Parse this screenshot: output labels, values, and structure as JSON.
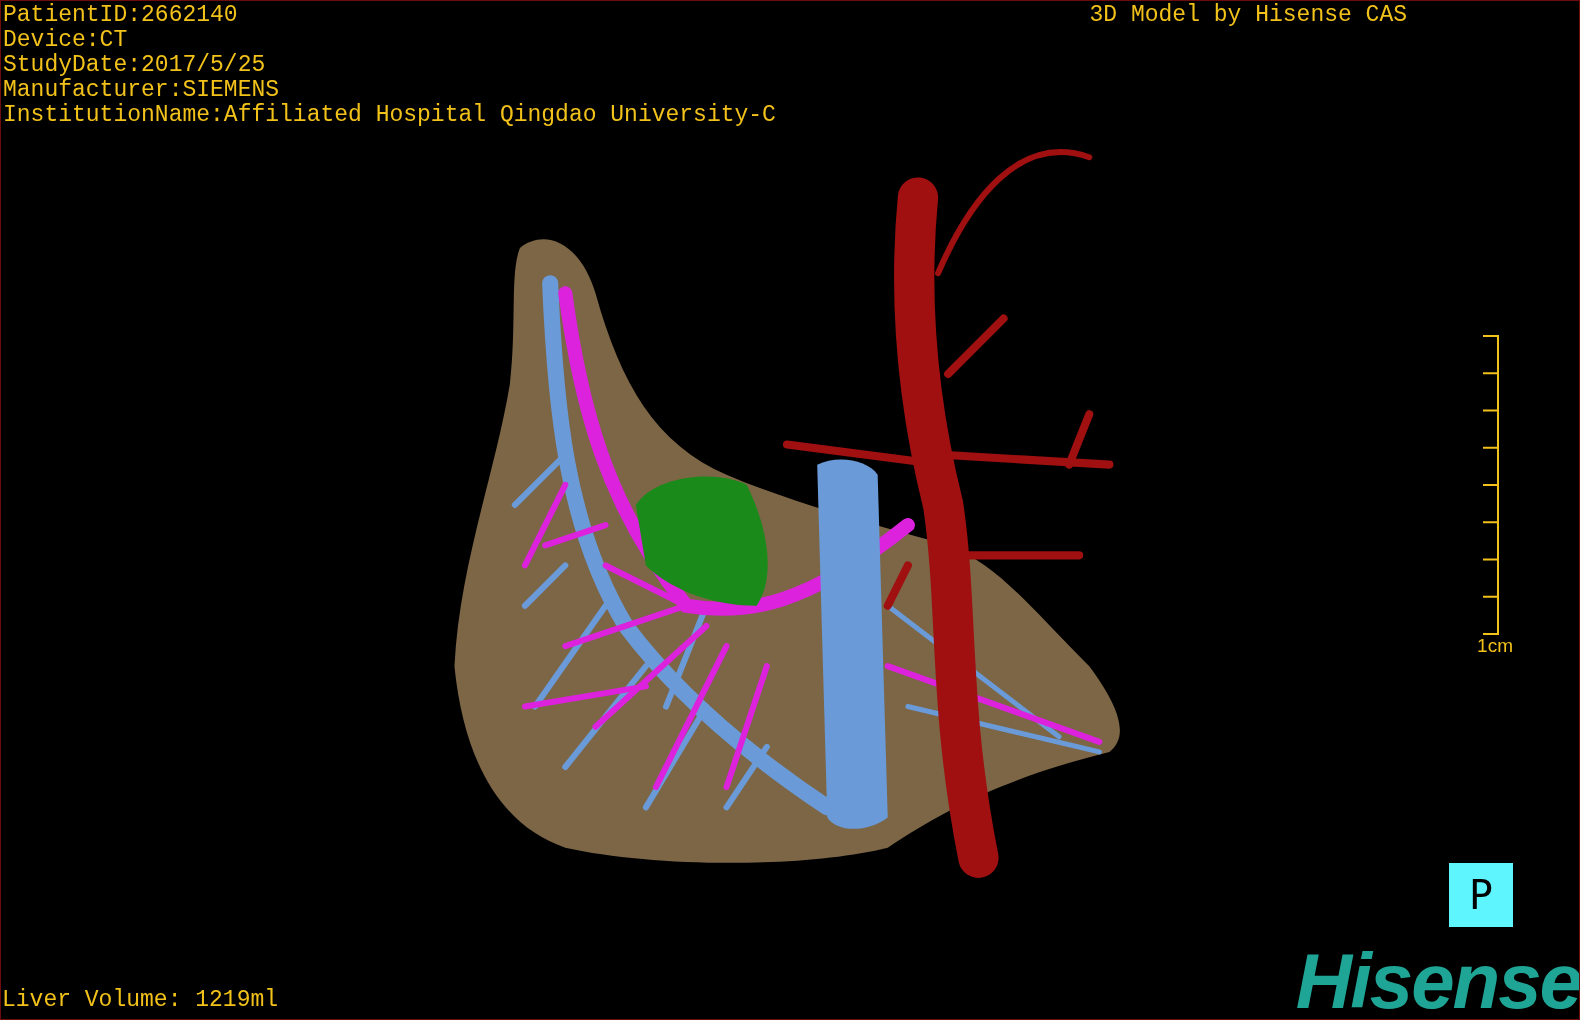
{
  "info_lines": [
    "PatientID:2662140",
    "Device:CT",
    "StudyDate:2017/5/25",
    "Manufacturer:SIEMENS",
    "InstitutionName:Affiliated Hospital Qingdao University-C"
  ],
  "model_title": "3D Model by Hisense CAS",
  "scale_bar": {
    "label": "1cm"
  },
  "liver_volume": "Liver Volume: 1219ml",
  "orientation_marker": "P",
  "logo": "Hisense"
}
